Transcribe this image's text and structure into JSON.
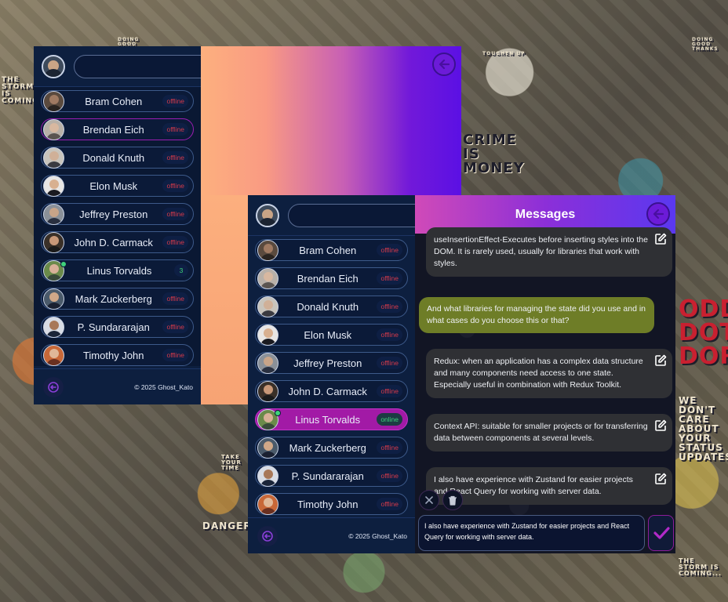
{
  "background": {
    "stickers": [
      "THE STORM IS COMING...",
      "CRIME IS MONEY",
      "WE DON'T CARE ABOUT YOUR STATUS UPDATES",
      "DANGER",
      "DOING GOOD THANKS",
      "TAKE YOUR TIME",
      "THE STORM IS COMING...",
      "ODD DOT DOR",
      "TOUGHEN UP",
      "DOING GOOD THANKS"
    ]
  },
  "colors": {
    "sidebar": "#0d1f3f",
    "offline": "#d53a4a",
    "online": "#3fd27b",
    "active_contact": "#a21aa6",
    "accent": "#6c1bd8",
    "own_message": "#6e7d27",
    "other_message": "#2f3034"
  },
  "back_window": {
    "search": {
      "value": "",
      "placeholder": ""
    },
    "contacts": [
      {
        "name": "Bram Cohen",
        "status": "offline"
      },
      {
        "name": "Brendan Eich",
        "status": "offline"
      },
      {
        "name": "Donald Knuth",
        "status": "offline"
      },
      {
        "name": "Elon Musk",
        "status": "offline"
      },
      {
        "name": "Jeffrey Preston",
        "status": "offline"
      },
      {
        "name": "John D. Carmack",
        "status": "offline"
      },
      {
        "name": "Linus Torvalds",
        "status": "3"
      },
      {
        "name": "Mark Zuckerberg",
        "status": "offline"
      },
      {
        "name": "P. Sundararajan",
        "status": "offline"
      },
      {
        "name": "Timothy John",
        "status": "offline"
      }
    ],
    "copyright": "© 2025 Ghost_Kato",
    "icons": {
      "back": "arrow-left-icon",
      "logout": "logout-icon"
    }
  },
  "front_window": {
    "search": {
      "value": "",
      "placeholder": ""
    },
    "contacts": [
      {
        "name": "Bram Cohen",
        "status": "offline"
      },
      {
        "name": "Brendan Eich",
        "status": "offline"
      },
      {
        "name": "Donald Knuth",
        "status": "offline"
      },
      {
        "name": "Elon Musk",
        "status": "offline"
      },
      {
        "name": "Jeffrey Preston",
        "status": "offline"
      },
      {
        "name": "John D. Carmack",
        "status": "offline"
      },
      {
        "name": "Linus Torvalds",
        "status": "online"
      },
      {
        "name": "Mark Zuckerberg",
        "status": "offline"
      },
      {
        "name": "P. Sundararajan",
        "status": "offline"
      },
      {
        "name": "Timothy John",
        "status": "offline"
      }
    ],
    "copyright": "© 2025 Ghost_Kato",
    "chat": {
      "title": "Messages",
      "messages": [
        {
          "author": "other",
          "text": "useInsertionEffect-Executes before inserting styles into the DOM. It is rarely used, usually for libraries that work with styles."
        },
        {
          "author": "me",
          "text": "And what libraries for managing the state did you use and in what cases do you choose this or that?"
        },
        {
          "author": "other",
          "text": "Redux: when an application has a complex data structure and many components need access to one state. Especially useful in combination with Redux Toolkit."
        },
        {
          "author": "other",
          "text": "Context API: suitable for smaller projects or for transferring data between components at several levels."
        },
        {
          "author": "other",
          "text": "I also have experience with Zustand for easier projects and React Query for working with server data."
        }
      ],
      "composer": {
        "value": "I also have experience with Zustand for easier projects and React Query for working with server data.",
        "icons": {
          "cancel": "close-icon",
          "delete": "trash-icon",
          "send": "checkmark-icon",
          "edit": "edit-icon"
        }
      }
    }
  }
}
